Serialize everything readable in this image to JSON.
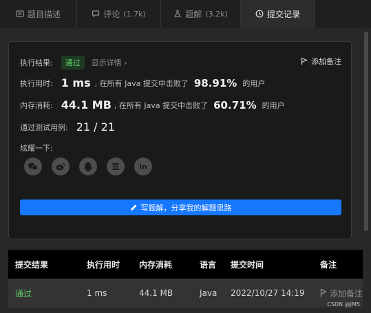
{
  "tabs": [
    {
      "label": "题目描述",
      "count": "",
      "icon": "description-icon"
    },
    {
      "label": "评论",
      "count": "(1.7k)",
      "icon": "comment-icon"
    },
    {
      "label": "题解",
      "count": "(3.2k)",
      "icon": "flask-icon"
    },
    {
      "label": "提交记录",
      "count": "",
      "icon": "clock-icon",
      "active": true
    }
  ],
  "result": {
    "status_label": "执行结果:",
    "status_value": "通过",
    "show_detail": "显示详情",
    "add_note": "添加备注",
    "runtime_label": "执行用时:",
    "runtime_value": "1 ms",
    "runtime_mid": ", 在所有 Java 提交中击败了",
    "runtime_pct": "98.91%",
    "runtime_suffix": "的用户",
    "memory_label": "内存消耗:",
    "memory_value": "44.1 MB",
    "memory_mid": ", 在所有 Java 提交中击败了",
    "memory_pct": "60.71%",
    "memory_suffix": "的用户",
    "tests_label": "通过测试用例:",
    "tests_value": "21 / 21",
    "share_label": "炫耀一下:",
    "share_icons": [
      "wechat-icon",
      "weibo-icon",
      "qq-icon",
      "douban-icon",
      "linkedin-icon"
    ],
    "douban_glyph": "豆",
    "linkedin_glyph": "in",
    "write_button": "写题解，分享我的解题思路"
  },
  "table": {
    "headers": [
      "提交结果",
      "执行用时",
      "内存消耗",
      "语言",
      "提交时间",
      "备注"
    ],
    "rows": [
      {
        "result": "通过",
        "runtime": "1 ms",
        "memory": "44.1 MB",
        "language": "Java",
        "time": "2022/10/27 14:19",
        "note": "添加备注"
      }
    ]
  },
  "watermark": "CSDN @JM5",
  "colors": {
    "accent": "#1677ff",
    "success": "#5fcf6a",
    "background": "#282828",
    "panel": "#1a1a1a"
  }
}
